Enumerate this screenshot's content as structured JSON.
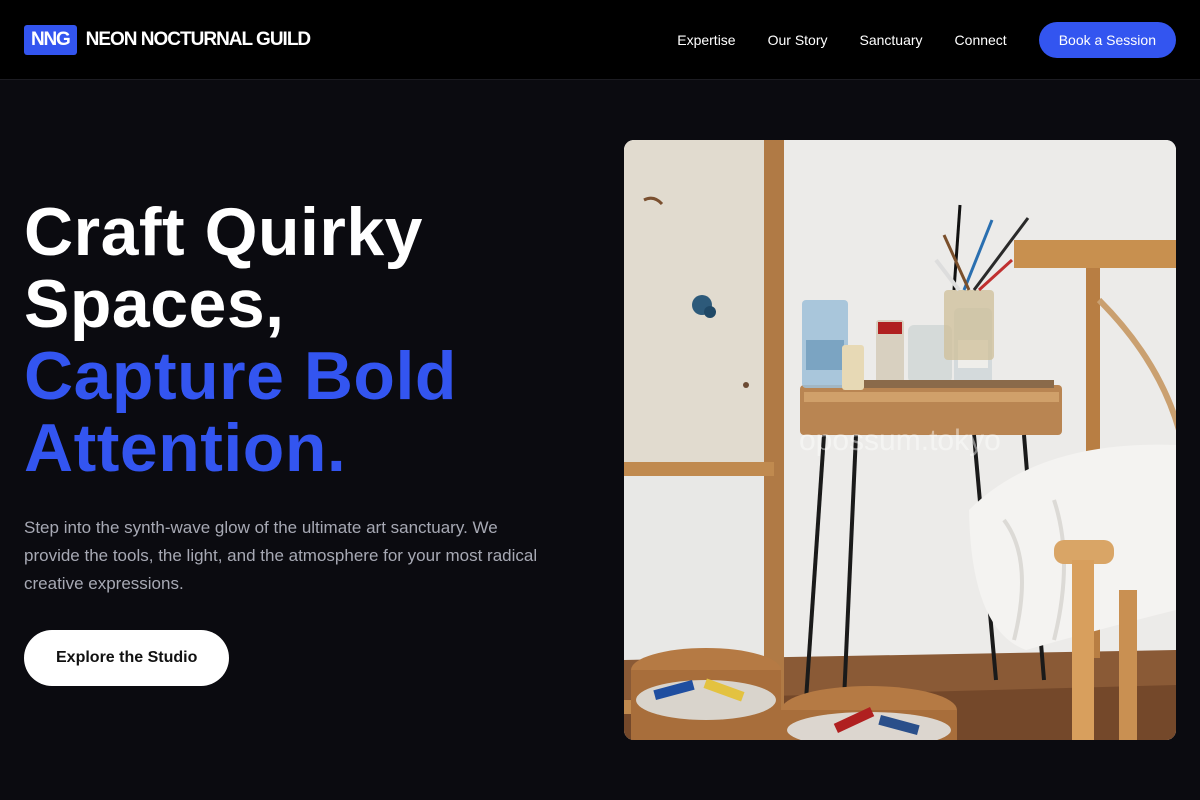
{
  "brand": {
    "badge": "NNG",
    "name": "NEON NOCTURNAL GUILD"
  },
  "nav": {
    "items": [
      "Expertise",
      "Our Story",
      "Sanctuary",
      "Connect"
    ],
    "cta": "Book a Session"
  },
  "hero": {
    "headline_line1": "Craft Quirky",
    "headline_line2": "Spaces,",
    "headline_accent_line1": "Capture Bold",
    "headline_accent_line2": "Attention.",
    "lead": "Step into the synth-wave glow of the ultimate art sanctuary. We provide the tools, the light, and the atmosphere for your most radical creative expressions.",
    "button": "Explore the Studio",
    "image_watermark": "opossum.tokyo"
  },
  "colors": {
    "accent": "#3355f0",
    "background": "#0b0b10",
    "header": "#000000",
    "muted_text": "#a7a9b4"
  }
}
